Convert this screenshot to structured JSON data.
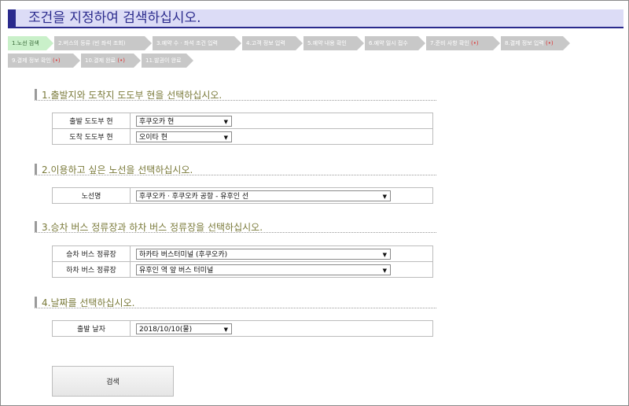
{
  "header": {
    "title": "조건을 지정하여 검색하십시오."
  },
  "steps": [
    {
      "label": "1.노선 검색",
      "dot": ""
    },
    {
      "label": "2.버스의 등류 (빈 좌석 조회)",
      "dot": ""
    },
    {
      "label": "3.예약 수 · 좌석 조건 입력",
      "dot": ""
    },
    {
      "label": "4.고객 정보 입력",
      "dot": ""
    },
    {
      "label": "5.예약 내용 확인",
      "dot": ""
    },
    {
      "label": "6.예약 일시 접수",
      "dot": ""
    },
    {
      "label": "7.준비 사항 확인",
      "dot": "(•)"
    },
    {
      "label": "8.결제 정보 입력",
      "dot": "(•)"
    },
    {
      "label": "9.결제 정보 확인",
      "dot": "(•)"
    },
    {
      "label": "10.결제 완료",
      "dot": "(•)"
    },
    {
      "label": "11.발권이 완료",
      "dot": ""
    }
  ],
  "sections": {
    "s1": {
      "title": "1.출발지와 도착지 도도부 현을 선택하십시오.",
      "rows": [
        {
          "label": "출발 도도부 현",
          "value": "후쿠오카 현"
        },
        {
          "label": "도착 도도부 현",
          "value": "오이타 현"
        }
      ]
    },
    "s2": {
      "title": "2.이용하고 싶은 노선을 선택하십시오.",
      "rows": [
        {
          "label": "노선명",
          "value": "후쿠오카 · 후쿠오카 공항 - 유후인 선"
        }
      ]
    },
    "s3": {
      "title": "3.승차 버스 정류장과 하차 버스 정류장을 선택하십시오.",
      "rows": [
        {
          "label": "승차 버스 정류장",
          "value": "하카타   버스터미널 (후쿠오카)"
        },
        {
          "label": "하차 버스 정류장",
          "value": "유후인 역 앞 버스 터미널"
        }
      ]
    },
    "s4": {
      "title": "4.날짜를 선택하십시오.",
      "rows": [
        {
          "label": "출발 날자",
          "value": "2018/10/10(물)"
        }
      ]
    }
  },
  "search_button": {
    "label": "검색"
  },
  "colors": {
    "accent": "#2a2a8c",
    "header_bg": "#dcdcf6",
    "active_step": "#c9f0c9",
    "inactive_step": "#c8c8c8",
    "section_title": "#7a7a3a"
  },
  "icons": {
    "dropdown": "dropdown-arrow-icon"
  }
}
